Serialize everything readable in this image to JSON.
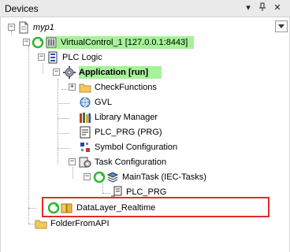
{
  "panel": {
    "title": "Devices",
    "buttons": {
      "dropdown": "▾",
      "pin": "ᵻ",
      "close": "✕"
    },
    "scroll_arrow": "down-arrow-icon"
  },
  "tree": {
    "root": {
      "label": "myp1",
      "icon": "project-file-icon"
    },
    "device": {
      "label": "VirtualControl_1  [127.0.0.1:8443]",
      "icon": "plc-device-icon",
      "status": "online"
    },
    "plc_logic": {
      "label": "PLC Logic",
      "icon": "plc-logic-icon"
    },
    "application": {
      "label": "Application [run]",
      "icon": "gear-icon"
    },
    "items": [
      {
        "label": "CheckFunctions",
        "icon": "folder-icon"
      },
      {
        "label": "GVL",
        "icon": "globe-icon"
      },
      {
        "label": "Library Manager",
        "icon": "library-icon"
      },
      {
        "label": "PLC_PRG (PRG)",
        "icon": "program-icon"
      },
      {
        "label": "Symbol Configuration",
        "icon": "symbol-config-icon"
      },
      {
        "label": "Task Configuration",
        "icon": "task-config-icon"
      }
    ],
    "maintask": {
      "label": "MainTask (IEC-Tasks)",
      "icon": "task-icon"
    },
    "plc_prg_call": {
      "label": "PLC_PRG",
      "icon": "program-call-icon"
    },
    "datalayer": {
      "label": "DataLayer_Realtime",
      "icon": "datalayer-icon"
    },
    "folder_api": {
      "label": "FolderFromAPI",
      "icon": "folder-icon"
    }
  },
  "colors": {
    "highlight": "#a6f19a",
    "annotation_box": "#e32b2b",
    "online_green": "#2eb82e"
  }
}
